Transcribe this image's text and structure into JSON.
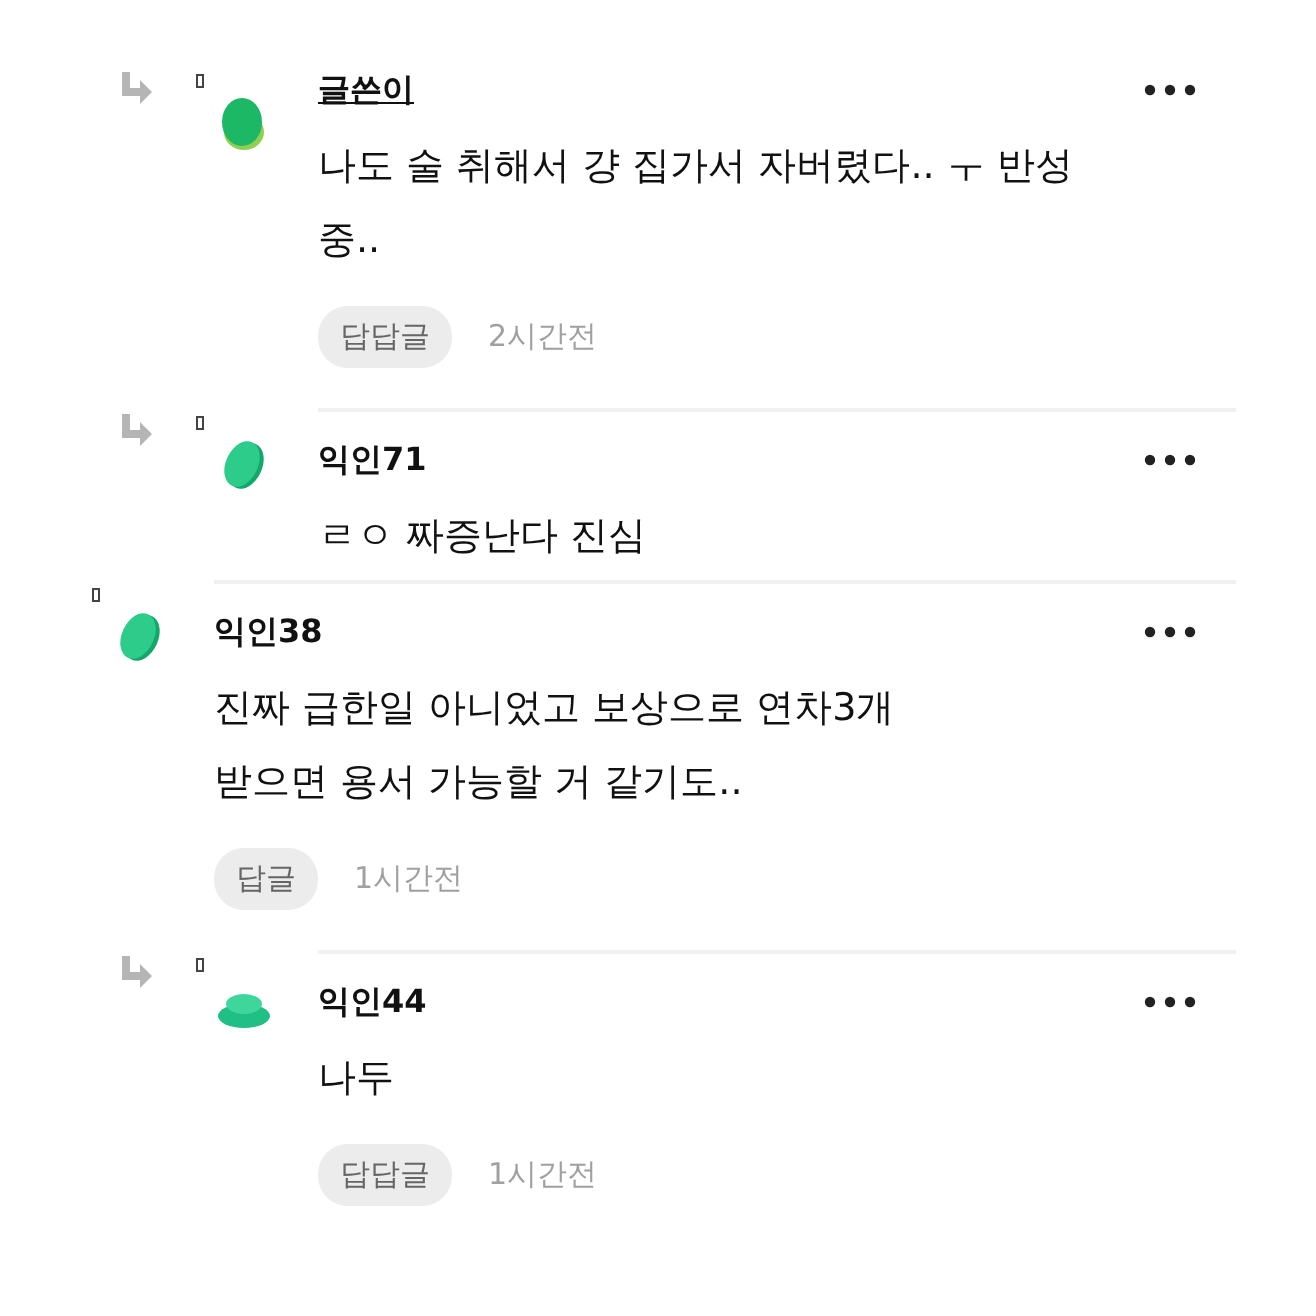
{
  "comments": [
    {
      "reply": true,
      "author": "글쓴이",
      "is_writer": true,
      "avatar": {
        "kind": "blob"
      },
      "body": [
        "나도 술 취해서 걍 집가서 자버렸다.. ㅜ 반성",
        "중.."
      ],
      "reply_button": "답답글",
      "time": "2시간전"
    },
    {
      "reply": true,
      "author": "익인71",
      "is_writer": false,
      "avatar": {
        "kind": "coin"
      },
      "body": [
        "ㄹㅇ 짜증난다 진심"
      ]
    },
    {
      "reply": false,
      "author": "익인38",
      "is_writer": false,
      "avatar": {
        "kind": "coin"
      },
      "body": [
        "진짜 급한일 아니었고 보상으로 연차3개",
        "받으면 용서 가능할 거 같기도.."
      ],
      "reply_button": "답글",
      "time": "1시간전"
    },
    {
      "reply": true,
      "author": "익인44",
      "is_writer": false,
      "avatar": {
        "kind": "stack"
      },
      "body": [
        "나두"
      ],
      "reply_button": "답답글",
      "time": "1시간전"
    }
  ]
}
